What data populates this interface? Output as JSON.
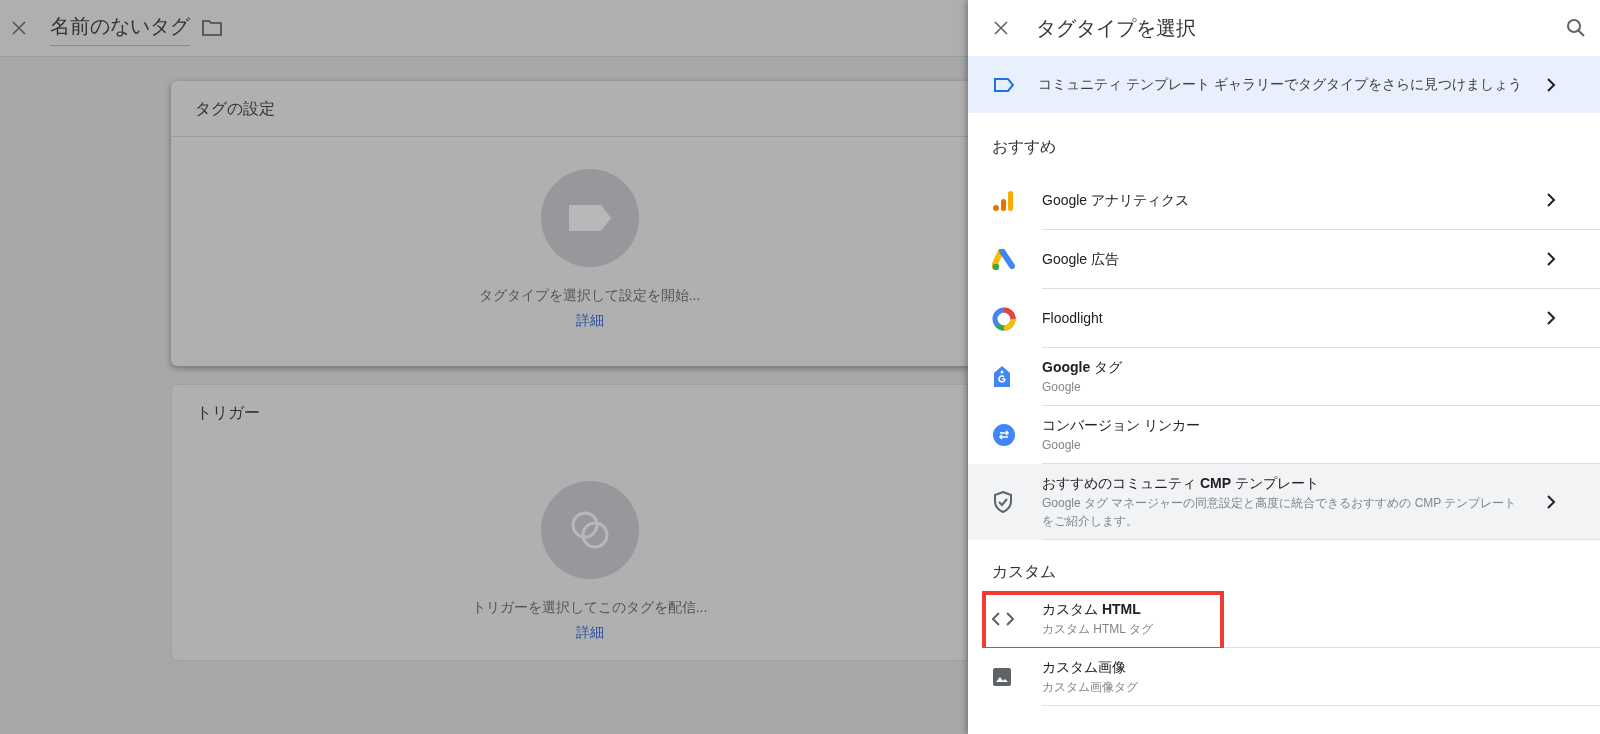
{
  "editor": {
    "title": "名前のないタグ",
    "cards": [
      {
        "heading": "タグの設定",
        "kind": "tag",
        "prompt": "タグタイプを選択して設定を開始...",
        "link": "詳細"
      },
      {
        "heading": "トリガー",
        "kind": "trigger",
        "prompt": "トリガーを選択してこのタグを配信...",
        "link": "詳細"
      }
    ]
  },
  "panel": {
    "title": "タグタイプを選択",
    "banner": "コミュニティ テンプレート ギャラリーでタグタイプをさらに見つけましょう",
    "sections": [
      {
        "heading": "おすすめ",
        "items": [
          {
            "kind": "analytics",
            "title": "Google アナリティクス",
            "chevron": true,
            "highlighted": false,
            "outlined": false
          },
          {
            "kind": "ads",
            "title": "Google 広告",
            "chevron": true,
            "highlighted": false,
            "outlined": false
          },
          {
            "kind": "floodlight",
            "title": "Floodlight",
            "chevron": true,
            "highlighted": false,
            "outlined": false
          },
          {
            "kind": "gtag",
            "title": "**Google** タグ",
            "subtitle": "Google",
            "chevron": false,
            "highlighted": false,
            "outlined": false
          },
          {
            "kind": "linker",
            "title": "コンバージョン リンカー",
            "subtitle": "Google",
            "chevron": false,
            "highlighted": false,
            "outlined": false
          },
          {
            "kind": "shield",
            "title": "おすすめのコミュニティ **CMP** テンプレート",
            "subtitle": "Google タグ マネージャーの同意設定と高度に統合できるおすすめの CMP テンプレートをご紹介します。",
            "chevron": true,
            "highlighted": true,
            "outlined": false
          }
        ]
      },
      {
        "heading": "カスタム",
        "items": [
          {
            "kind": "code",
            "title": "カスタム **HTML**",
            "subtitle": "カスタム HTML タグ",
            "chevron": false,
            "highlighted": false,
            "outlined": true
          },
          {
            "kind": "image",
            "title": "カスタム画像",
            "subtitle": "カスタム画像タグ",
            "chevron": false,
            "highlighted": false,
            "outlined": false
          }
        ]
      }
    ]
  }
}
